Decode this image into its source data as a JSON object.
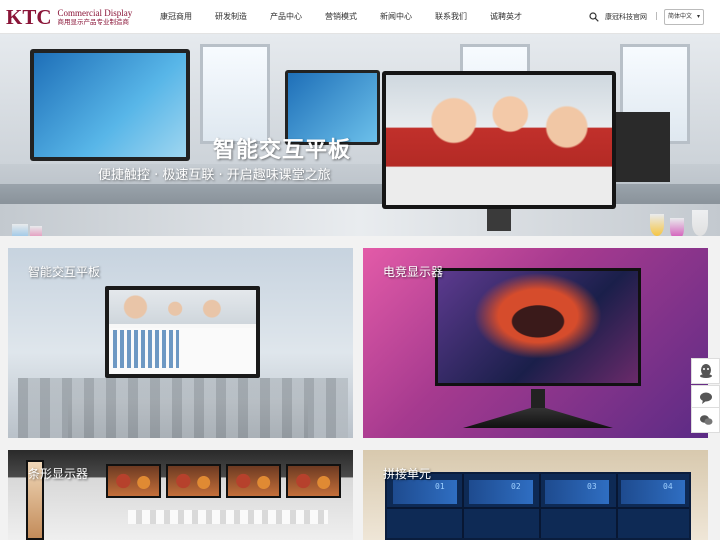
{
  "header": {
    "logo_mark": "KTC",
    "logo_en": "Commercial Display",
    "logo_cn": "商用显示产品专业制造商",
    "nav": [
      "康冠商用",
      "研发制造",
      "产品中心",
      "营销模式",
      "新闻中心",
      "联系我们",
      "诚聘英才"
    ],
    "official_site": "康冠科技官网",
    "separator": "|",
    "language": "简体中文"
  },
  "hero": {
    "title": "智能交互平板",
    "subtitle": "便捷触控 · 极速互联 · 开启趣味课堂之旅"
  },
  "products": [
    {
      "label": "智能交互平板"
    },
    {
      "label": "电竞显示器"
    },
    {
      "label": "条形显示器"
    },
    {
      "label": "拼接单元"
    }
  ],
  "videowall_numbers": [
    "01",
    "02",
    "03",
    "04"
  ],
  "icons": {
    "search": "search-icon",
    "chevron": "chevron-down-icon",
    "qq": "qq-icon",
    "chat": "chat-icon"
  },
  "colors": {
    "brand": "#8a1538"
  }
}
